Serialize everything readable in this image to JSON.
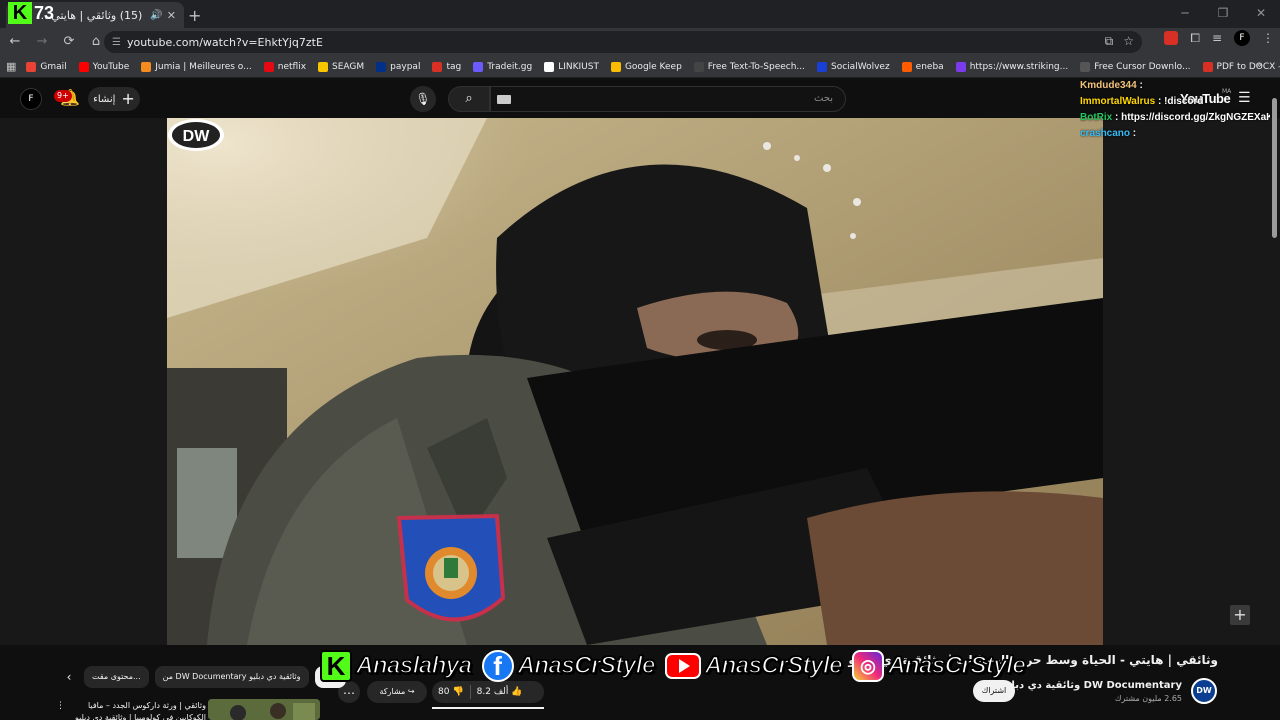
{
  "browser": {
    "tab_title": "(15) وثائقي | هايتي - الحياة",
    "url": "youtube.com/watch?v=EhktYjq7ztE",
    "brand_overlay": "73",
    "bookmarks": [
      {
        "label": "Gmail",
        "color": "#ea4335"
      },
      {
        "label": "YouTube",
        "color": "#ff0000"
      },
      {
        "label": "Jumia | Meilleures o...",
        "color": "#f68b1e"
      },
      {
        "label": "netflix",
        "color": "#e50914"
      },
      {
        "label": "SEAGM",
        "color": "#f7c600"
      },
      {
        "label": "paypal",
        "color": "#003087"
      },
      {
        "label": "tag",
        "color": "#d93025"
      },
      {
        "label": "Tradeit.gg",
        "color": "#6b5bff"
      },
      {
        "label": "LINKIUST",
        "color": "#ffffff"
      },
      {
        "label": "Google Keep",
        "color": "#fbbc04"
      },
      {
        "label": "Free Text-To-Speech...",
        "color": "#444444"
      },
      {
        "label": "SocialWolvez",
        "color": "#1a3fd6"
      },
      {
        "label": "eneba",
        "color": "#ff5b00"
      },
      {
        "label": "https://www.striking...",
        "color": "#7c3aed"
      },
      {
        "label": "Free Cursor Downlo...",
        "color": "#555555"
      },
      {
        "label": "PDF to DOCX – Con...",
        "color": "#d93025"
      }
    ]
  },
  "youtube": {
    "avatar_letter": "F",
    "notification_count": "9+",
    "create_label": "إنشاء",
    "search_placeholder": "بحث",
    "logo_text": "YouTube",
    "logo_region": "MA"
  },
  "chat": [
    {
      "user": "Kmdude344",
      "message": " : ",
      "user_class": "u1"
    },
    {
      "user": "ImmortalWalrus",
      "message": " : !discord",
      "user_class": "u2"
    },
    {
      "user": "BotRix",
      "message": " : https://discord.gg/ZkgNGZEXaK",
      "user_class": "u3"
    },
    {
      "user": "crashcano",
      "message": " : ",
      "user_class": "u4"
    }
  ],
  "video": {
    "title": "وثائقي | هايتي - الحياة وسط حرب العصابات | وثائقية دي دبليو",
    "watermark": "DW",
    "channel_name": "DW Documentary وثائقية دي دبليو",
    "subscribers": "2.65 مليون مشترك",
    "subscribe_label": "اشتراك",
    "likes": "8.2 ألف",
    "dislikes": "80",
    "share_label": "مشاركة",
    "more_label": "…"
  },
  "chips": [
    {
      "label": "الكل",
      "active": true
    },
    {
      "label": "من DW Documentary وثائقية دي دبليو",
      "active": false
    },
    {
      "label": "محتوى مقت...",
      "active": false
    }
  ],
  "recommended": {
    "title": "وثائقي | ورثة داركوس الجدد – مافيا الكوكايين في كولومبيا | وثائقية دي دبليو"
  },
  "banner": {
    "items": [
      {
        "platform": "kick-icon",
        "handle": "Anaslahya"
      },
      {
        "platform": "facebook-icon",
        "handle": "AnasCrStyle"
      },
      {
        "platform": "youtube-icon",
        "handle": "AnasCrStyle"
      },
      {
        "platform": "instagram-icon",
        "handle": "AnasCrStyle"
      }
    ]
  }
}
